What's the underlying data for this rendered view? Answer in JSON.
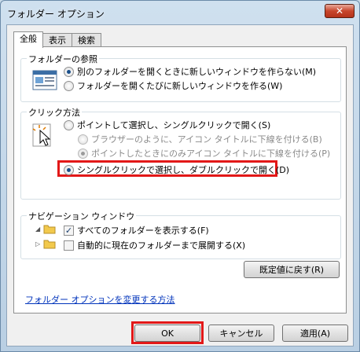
{
  "window": {
    "title": "フォルダー オプション",
    "close_label": "✕"
  },
  "tabs": [
    {
      "label": "全般"
    },
    {
      "label": "表示"
    },
    {
      "label": "検索"
    }
  ],
  "folder_browse": {
    "label": "フォルダーの参照",
    "options": [
      {
        "label": "別のフォルダーを開くときに新しいウィンドウを作らない(M)",
        "checked": true
      },
      {
        "label": "フォルダーを開くたびに新しいウィンドウを作る(W)",
        "checked": false
      }
    ]
  },
  "click_method": {
    "label": "クリック方法",
    "option_single": "ポイントして選択し、シングルクリックで開く(S)",
    "sub_browser": "ブラウザーのように、アイコン タイトルに下線を付ける(B)",
    "sub_point": "ポイントしたときにのみアイコン タイトルに下線を付ける(P)",
    "option_double": "シングルクリックで選択し、ダブルクリックで開く(D)"
  },
  "navigation": {
    "label": "ナビゲーション ウィンドウ",
    "show_all": "すべてのフォルダーを表示する(F)",
    "auto_expand": "自動的に現在のフォルダーまで展開する(X)"
  },
  "restore_defaults": "既定値に戻す(R)",
  "help_link": "フォルダー オプションを変更する方法",
  "buttons": {
    "ok": "OK",
    "cancel": "キャンセル",
    "apply": "適用(A)"
  },
  "colors": {
    "highlight": "#e21818",
    "link": "#0033bb"
  }
}
